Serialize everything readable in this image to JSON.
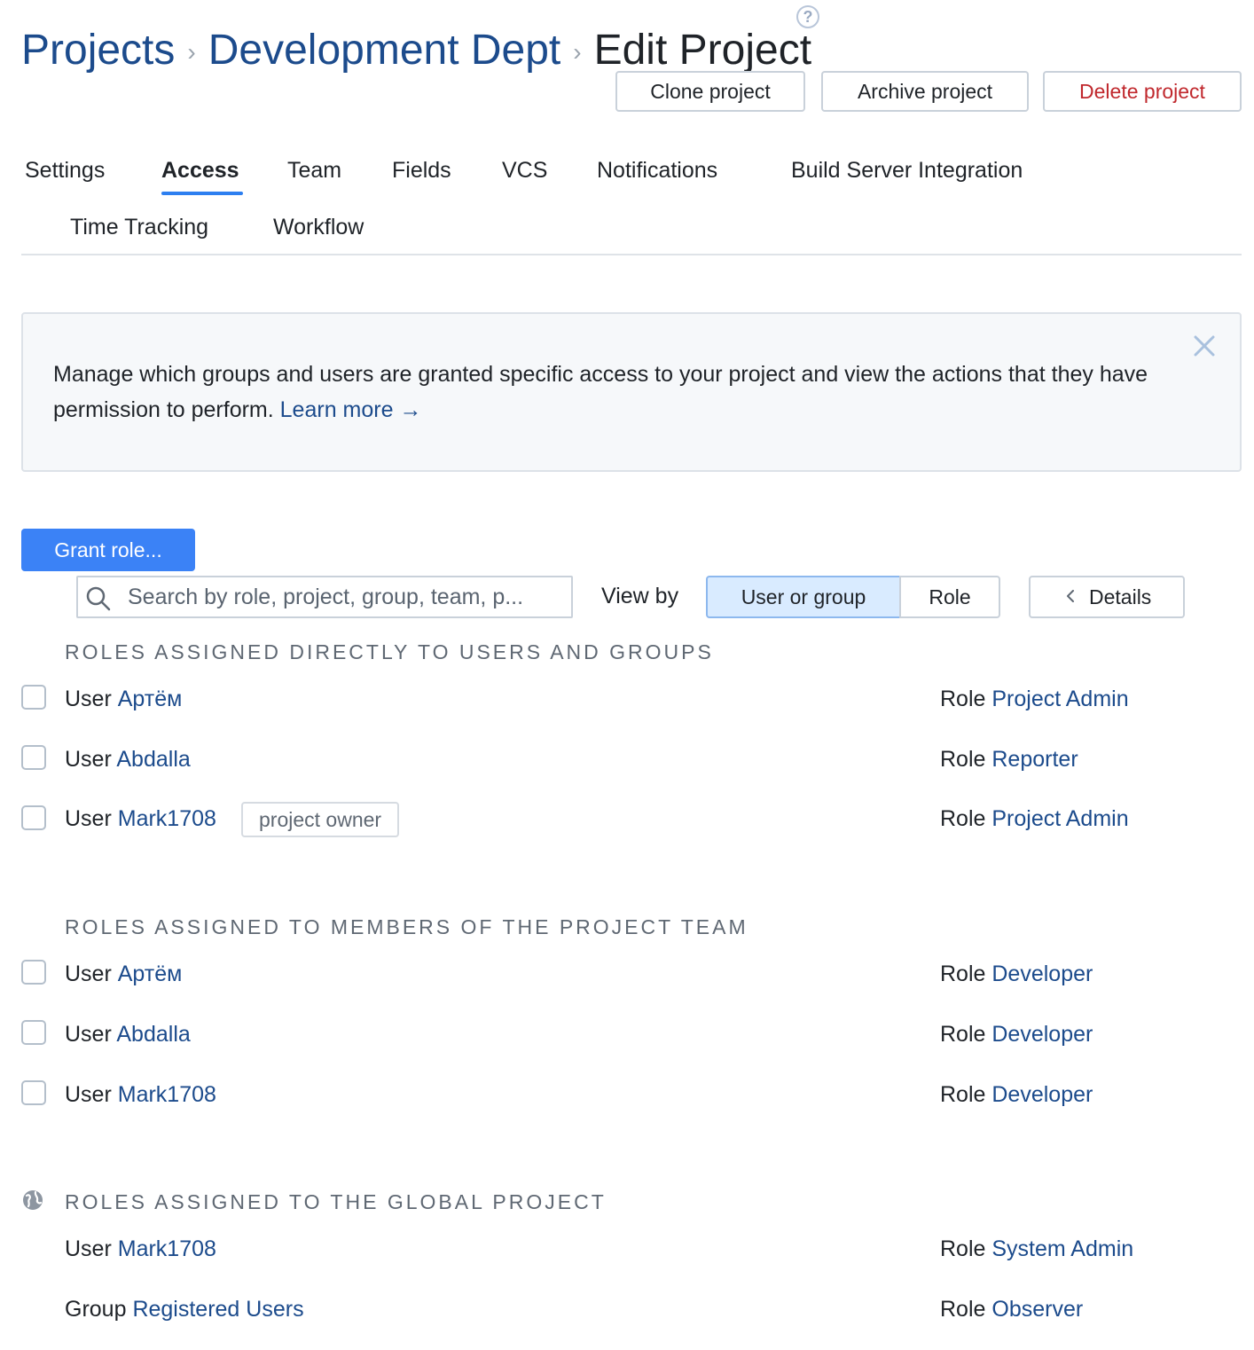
{
  "header": {
    "breadcrumbs": [
      "Projects",
      "Development Dept"
    ],
    "separator": "›",
    "current": "Edit Project",
    "help_icon": "help-circle-icon",
    "help_glyph": "?"
  },
  "actions": {
    "clone": "Clone project",
    "archive": "Archive project",
    "delete": "Delete project",
    "danger_color": "#c0282d"
  },
  "tabs": [
    {
      "label": "Settings",
      "active": false
    },
    {
      "label": "Access",
      "active": true
    },
    {
      "label": "Team",
      "active": false
    },
    {
      "label": "Fields",
      "active": false
    },
    {
      "label": "VCS",
      "active": false
    },
    {
      "label": "Notifications",
      "active": false
    },
    {
      "label": "Build Server Integration",
      "active": false
    },
    {
      "label": "Time Tracking",
      "active": false
    },
    {
      "label": "Workflow",
      "active": false
    }
  ],
  "banner": {
    "text": "Manage which groups and users are granted specific access to your project and view the actions that they have permission to perform.",
    "link": "Learn more →",
    "close_icon": "close-icon"
  },
  "toolbar": {
    "grant_role": "Grant role...",
    "search_placeholder": "Search by role, project, group, team, p...",
    "view_by_label": "View by",
    "view_by_options": [
      "User or group",
      "Role"
    ],
    "view_by_selected": "User or group",
    "details": "Details",
    "accent_color": "#3b82f6"
  },
  "sections": {
    "direct": {
      "heading": "ROLES ASSIGNED DIRECTLY TO USERS AND GROUPS",
      "rows": [
        {
          "subject_type": "User",
          "subject": "Артём",
          "role_prefix": "Role",
          "role": "Project Admin"
        },
        {
          "subject_type": "User",
          "subject": "Abdalla",
          "role_prefix": "Role",
          "role": "Reporter"
        },
        {
          "subject_type": "User",
          "subject": "Mark1708",
          "tag": "project owner",
          "role_prefix": "Role",
          "role": "Project Admin"
        }
      ]
    },
    "team": {
      "heading": "ROLES ASSIGNED TO MEMBERS OF THE PROJECT TEAM",
      "rows": [
        {
          "subject_type": "User",
          "subject": "Артём",
          "role_prefix": "Role",
          "role": "Developer"
        },
        {
          "subject_type": "User",
          "subject": "Abdalla",
          "role_prefix": "Role",
          "role": "Developer"
        },
        {
          "subject_type": "User",
          "subject": "Mark1708",
          "role_prefix": "Role",
          "role": "Developer"
        }
      ]
    },
    "global": {
      "heading": "ROLES ASSIGNED TO THE GLOBAL PROJECT",
      "icon": "globe-icon",
      "rows": [
        {
          "subject_type": "User",
          "subject": "Mark1708",
          "role_prefix": "Role",
          "role": "System Admin"
        },
        {
          "subject_type": "Group",
          "subject": "Registered Users",
          "role_prefix": "Role",
          "role": "Observer"
        }
      ]
    }
  }
}
